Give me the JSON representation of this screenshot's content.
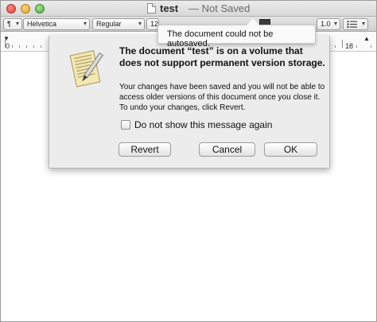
{
  "window": {
    "title_name": "test",
    "title_status": "— Not Saved"
  },
  "toolbar": {
    "paragraph_symbol": "¶",
    "font_family": "Helvetica",
    "font_style": "Regular",
    "font_size": "12",
    "line_spacing": "1.0",
    "chevron": "▾"
  },
  "ruler": {
    "start_label": "0",
    "end_label": "18"
  },
  "tooltip": {
    "text": "The document could not be autosaved."
  },
  "dialog": {
    "heading": "The document “test” is on a volume that does not support permanent version storage.",
    "body": "Your changes have been saved and you will not be able to access older versions of this document once you close it. To undo your changes, click Revert.",
    "checkbox_label": "Do not show this message again",
    "checkbox_checked": false,
    "buttons": {
      "revert": "Revert",
      "cancel": "Cancel",
      "ok": "OK"
    }
  },
  "icons": {
    "app_icon": "textedit-icon",
    "document_icon": "document-icon",
    "list_icon": "list-icon"
  }
}
